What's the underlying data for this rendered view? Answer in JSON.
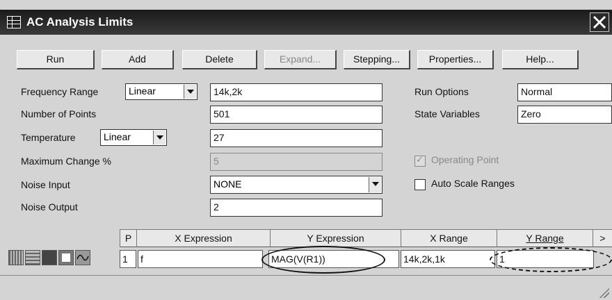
{
  "window": {
    "title": "AC Analysis Limits",
    "close_icon": "close-icon"
  },
  "toolbar": {
    "buttons": [
      {
        "label": "Run",
        "enabled": true
      },
      {
        "label": "Add",
        "enabled": true
      },
      {
        "label": "Delete",
        "enabled": true
      },
      {
        "label": "Expand...",
        "enabled": false
      },
      {
        "label": "Stepping...",
        "enabled": true
      },
      {
        "label": "Properties...",
        "enabled": true
      },
      {
        "label": "Help...",
        "enabled": true
      }
    ]
  },
  "form": {
    "frequency_range": {
      "label": "Frequency Range",
      "mode": "Linear",
      "value": "14k,2k"
    },
    "number_of_points": {
      "label": "Number of Points",
      "value": "501"
    },
    "temperature": {
      "label": "Temperature",
      "mode": "Linear",
      "value": "27"
    },
    "maximum_change": {
      "label": "Maximum Change %",
      "value": "5"
    },
    "noise_input": {
      "label": "Noise Input",
      "value": "NONE"
    },
    "noise_output": {
      "label": "Noise Output",
      "value": "2"
    },
    "run_options": {
      "label": "Run Options",
      "value": "Normal"
    },
    "state_variables": {
      "label": "State Variables",
      "value": "Zero"
    },
    "operating_point": {
      "label": "Operating Point",
      "checked": true,
      "enabled": false
    },
    "auto_scale_ranges": {
      "label": "Auto Scale Ranges",
      "checked": false
    }
  },
  "grid": {
    "headers": [
      "P",
      "X Expression",
      "Y Expression",
      "X Range",
      "Y Range",
      ">"
    ],
    "rows": [
      {
        "p": "1",
        "x_expression": "f",
        "y_expression": "MAG(V(R1))",
        "x_range": "14k,2k,1k",
        "y_range": "1"
      }
    ]
  }
}
